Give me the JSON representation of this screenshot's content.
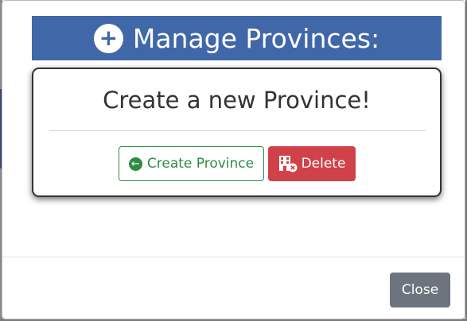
{
  "header": {
    "title": "Manage Provinces:",
    "icon": "plus-circle-icon",
    "background_color": "#4068a8"
  },
  "card": {
    "title": "Create a new Province!",
    "create_button": {
      "label": "Create Province",
      "icon": "arrow-left-circle-icon",
      "color": "#2f8a45"
    },
    "delete_button": {
      "label": "Delete",
      "icon": "building-remove-icon",
      "color": "#d14149"
    }
  },
  "footer": {
    "close_label": "Close",
    "close_color": "#6c757d"
  }
}
